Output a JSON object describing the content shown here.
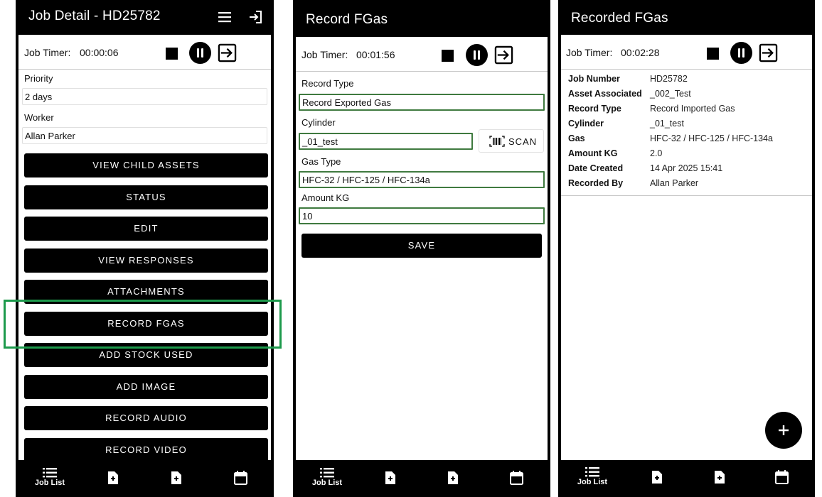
{
  "panel1": {
    "title": "Job Detail - HD25782",
    "timer_label": "Job Timer:",
    "timer_value": "00:00:06",
    "fields": [
      {
        "label": "Priority",
        "value": "2 days"
      },
      {
        "label": "Worker",
        "value": "Allan Parker"
      }
    ],
    "buttons": [
      "VIEW CHILD ASSETS",
      "STATUS",
      "EDIT",
      "VIEW RESPONSES",
      "ATTACHMENTS",
      "RECORD FGAS",
      "ADD STOCK USED",
      "ADD IMAGE",
      "RECORD AUDIO",
      "RECORD VIDEO"
    ],
    "nav_label": "Job List"
  },
  "panel2": {
    "title": "Record FGas",
    "timer_label": "Job Timer:",
    "timer_value": "00:01:56",
    "record_type_label": "Record Type",
    "record_type_value": "Record Exported Gas",
    "cylinder_label": "Cylinder",
    "cylinder_value": "_01_test",
    "scan_label": "SCAN",
    "gas_type_label": "Gas Type",
    "gas_type_value": "HFC-32 / HFC-125 / HFC-134a",
    "amount_label": "Amount KG",
    "amount_value": "10",
    "save_label": "SAVE",
    "nav_label": "Job List"
  },
  "panel3": {
    "title": "Recorded FGas",
    "timer_label": "Job Timer:",
    "timer_value": "00:02:28",
    "details": [
      {
        "k": "Job Number",
        "v": "HD25782"
      },
      {
        "k": "Asset Associated",
        "v": "_002_Test"
      },
      {
        "k": "Record Type",
        "v": "Record Imported Gas"
      },
      {
        "k": "Cylinder",
        "v": "_01_test"
      },
      {
        "k": "Gas",
        "v": "HFC-32 / HFC-125 / HFC-134a"
      },
      {
        "k": "Amount KG",
        "v": "2.0"
      },
      {
        "k": "Date Created",
        "v": "14 Apr 2025 15:41"
      },
      {
        "k": "Recorded By",
        "v": "Allan Parker"
      }
    ],
    "fab_label": "+",
    "nav_label": "Job List"
  },
  "colors": {
    "highlight": "#1d9a4c",
    "field_border": "#3f7a3f"
  }
}
